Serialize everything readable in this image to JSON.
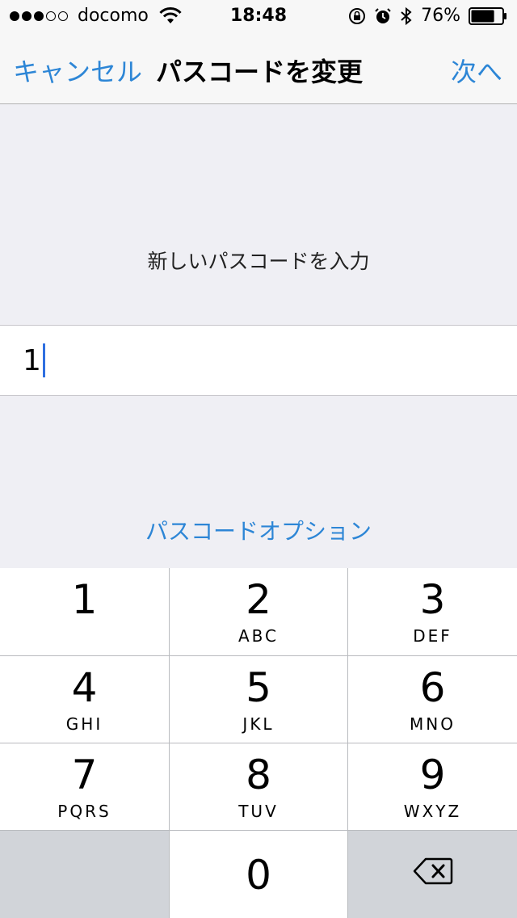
{
  "status_bar": {
    "signal_filled": 3,
    "signal_total": 5,
    "carrier": "docomo",
    "time": "18:48",
    "battery_percent": "76%",
    "battery_level": 0.76,
    "icons": [
      "wifi-icon",
      "orientation-lock-icon",
      "alarm-icon",
      "bluetooth-icon",
      "battery-icon"
    ]
  },
  "nav": {
    "cancel_label": "キャンセル",
    "title": "パスコードを変更",
    "next_label": "次へ"
  },
  "prompt": "新しいパスコードを入力",
  "input": {
    "value": "1"
  },
  "options_link": "パスコードオプション",
  "keypad": {
    "keys": [
      {
        "num": "1",
        "letters": ""
      },
      {
        "num": "2",
        "letters": "ABC"
      },
      {
        "num": "3",
        "letters": "DEF"
      },
      {
        "num": "4",
        "letters": "GHI"
      },
      {
        "num": "5",
        "letters": "JKL"
      },
      {
        "num": "6",
        "letters": "MNO"
      },
      {
        "num": "7",
        "letters": "PQRS"
      },
      {
        "num": "8",
        "letters": "TUV"
      },
      {
        "num": "9",
        "letters": "WXYZ"
      },
      {
        "num": "0",
        "letters": ""
      }
    ]
  },
  "colors": {
    "accent": "#2d86d6",
    "background": "#efeff4",
    "keypad_gray": "#d1d4d9"
  }
}
